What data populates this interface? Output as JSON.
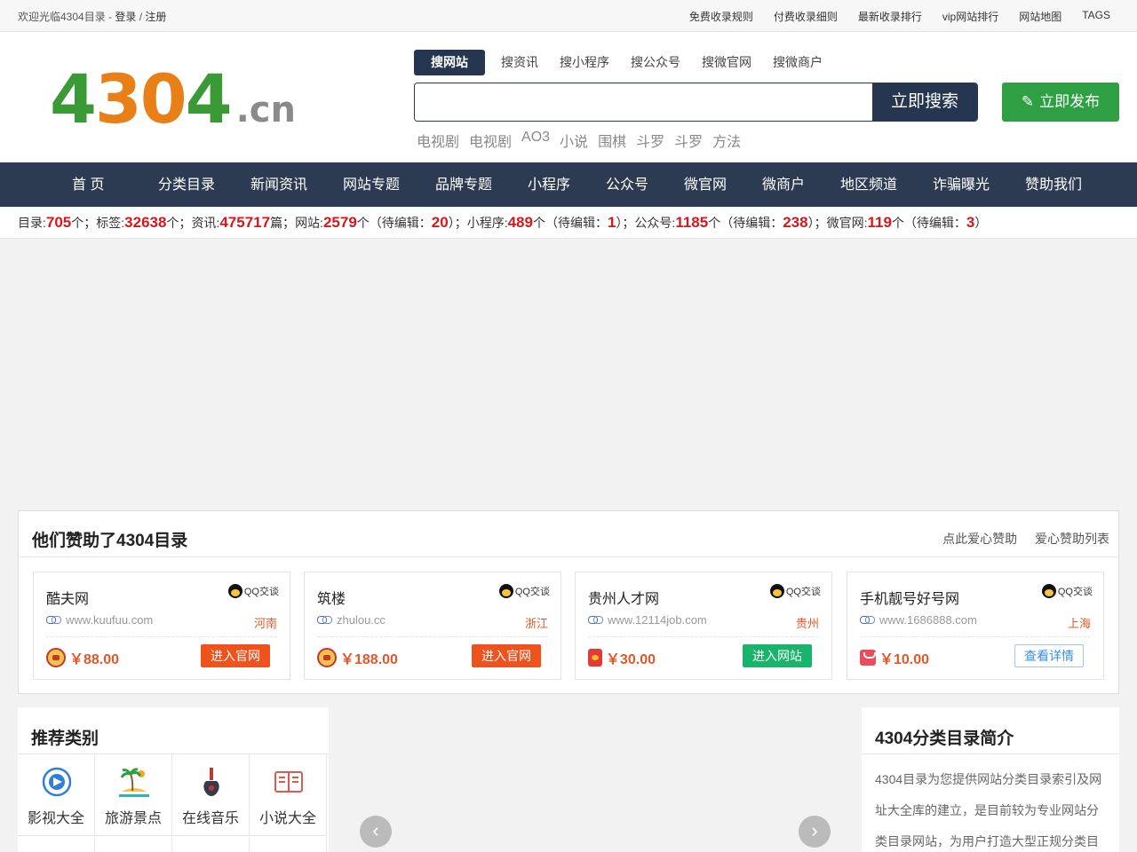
{
  "topbar": {
    "welcome": "欢迎光临4304目录 - ",
    "login": "登录",
    "sep": " / ",
    "register": "注册",
    "links": [
      "免费收录规则",
      "付费收录细则",
      "最新收录排行",
      "vip网站排行",
      "网站地图",
      "TAGS"
    ]
  },
  "logo": {
    "digits": [
      "4",
      "3",
      "0",
      "4"
    ],
    "suffix": ".cn"
  },
  "search": {
    "tabs": [
      "搜网站",
      "搜资讯",
      "搜小程序",
      "搜公众号",
      "搜微官网",
      "搜微商户"
    ],
    "active_tab": "搜网站",
    "placeholder": "",
    "button": "立即搜索",
    "hotwords": [
      "电视剧",
      "电视剧",
      "AO3",
      "小说",
      "围棋",
      "斗罗",
      "斗罗",
      "方法"
    ]
  },
  "publish": {
    "label": "立即发布",
    "icon": "pencil-icon"
  },
  "nav": [
    "首 页",
    "分类目录",
    "新闻资讯",
    "网站专题",
    "品牌专题",
    "小程序",
    "公众号",
    "微官网",
    "微商户",
    "地区频道",
    "诈骗曝光",
    "赞助我们"
  ],
  "stats": {
    "dir_label": "目录:",
    "dir": "705",
    "dir_unit": "个；",
    "tag_label": "标签:",
    "tag": "32638",
    "tag_unit": "个；",
    "news_label": "资讯:",
    "news": "475717",
    "news_unit": "篇；",
    "site_label": "网站:",
    "site": "2579",
    "site_unit": "个（待编辑：",
    "site_pending": "20",
    "site_end": "）；",
    "mini_label": "小程序:",
    "mini": "489",
    "mini_unit": "个（待编辑：",
    "mini_pending": "1",
    "mini_end": "）；",
    "mp_label": "公众号:",
    "mp": "1185",
    "mp_unit": "个（待编辑：",
    "mp_pending": "238",
    "mp_end": "）；",
    "wg_label": "微官网:",
    "wg": "119",
    "wg_unit": "个（待编辑：",
    "wg_pending": "3",
    "wg_end": "）"
  },
  "sponsors": {
    "title": "他们赞助了4304目录",
    "links": [
      "点此爱心赞助",
      "爱心赞助列表"
    ],
    "qq_label": "QQ交谈",
    "cards": [
      {
        "name": "酷夫网",
        "url": "www.kuufuu.com",
        "region": "河南",
        "price": "￥88.00",
        "button": "进入官网",
        "price_icon": "fortune-god-icon"
      },
      {
        "name": "筑楼",
        "url": "zhulou.cc",
        "region": "浙江",
        "price": "￥188.00",
        "button": "进入官网",
        "price_icon": "fortune-god-icon"
      },
      {
        "name": "贵州人才网",
        "url": "www.12114job.com",
        "region": "贵州",
        "price": "￥30.00",
        "button": "进入网站",
        "price_icon": "red-envelope-icon"
      },
      {
        "name": "手机靓号好号网",
        "url": "www.1686888.com",
        "region": "上海",
        "price": "￥10.00",
        "button": "查看详情",
        "price_icon": "gift-icon"
      }
    ]
  },
  "recommend": {
    "title": "推荐类别",
    "items": [
      {
        "label": "影视大全",
        "icon": "film-icon"
      },
      {
        "label": "旅游景点",
        "icon": "island-icon"
      },
      {
        "label": "在线音乐",
        "icon": "guitar-icon"
      },
      {
        "label": "小说大全",
        "icon": "book-icon"
      }
    ]
  },
  "slider": {
    "prev": "‹",
    "next": "›"
  },
  "intro": {
    "title": "4304分类目录简介",
    "text": "4304目录为您提供网站分类目录索引及网址大全库的建立，是目前较为专业网站分类目录网站，为用户打造大型正规分类目"
  },
  "colors": {
    "nav_bg": "#2d3b52",
    "accent_red": "#d9161b",
    "publish_green": "#2ea043",
    "logo_green": "#3a9a35",
    "logo_orange": "#e87f17"
  }
}
